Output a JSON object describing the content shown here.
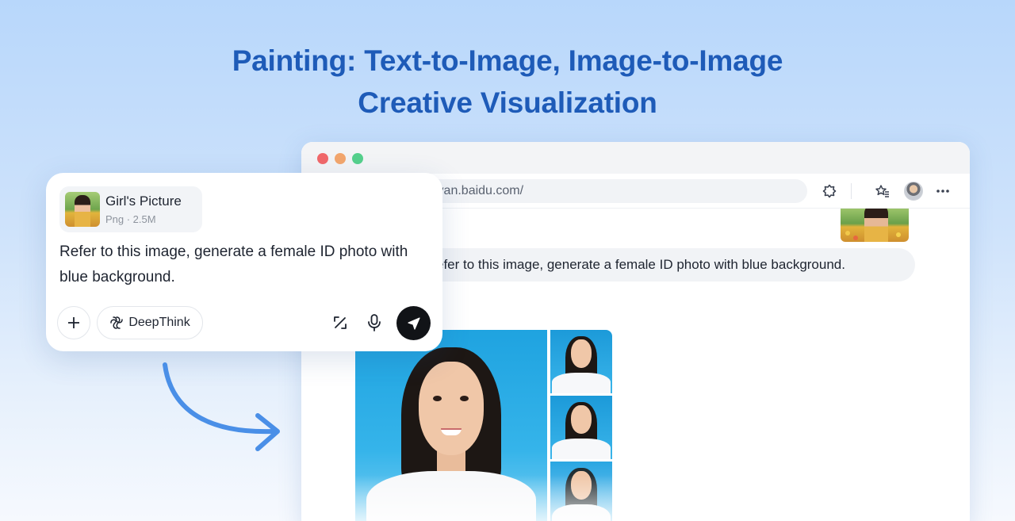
{
  "headline": {
    "line1": "Painting: Text-to-Image, Image-to-Image",
    "line2": "Creative Visualization"
  },
  "browser": {
    "url": "yiyan.baidu.com/",
    "toolbar_icons": [
      "extension-icon",
      "favorites-icon",
      "avatar",
      "more-icon"
    ],
    "user_message": "Refer to this image, generate a female ID photo with blue background.",
    "user_message_visible": "efer to this image, generate a female ID photo with blue background."
  },
  "input_card": {
    "attachment": {
      "name": "Girl's Picture",
      "meta": "Png · 2.5M"
    },
    "prompt": "Refer to this image, generate a female ID photo with blue background.",
    "deepthink_label": "DeepThink",
    "icons": [
      "plus-icon",
      "deepthink-icon",
      "slash-tool-icon",
      "microphone-icon",
      "send-icon"
    ]
  },
  "colors": {
    "headline": "#1e5bb8",
    "accent_arrow": "#4a8fe7",
    "send_button": "#111317"
  }
}
